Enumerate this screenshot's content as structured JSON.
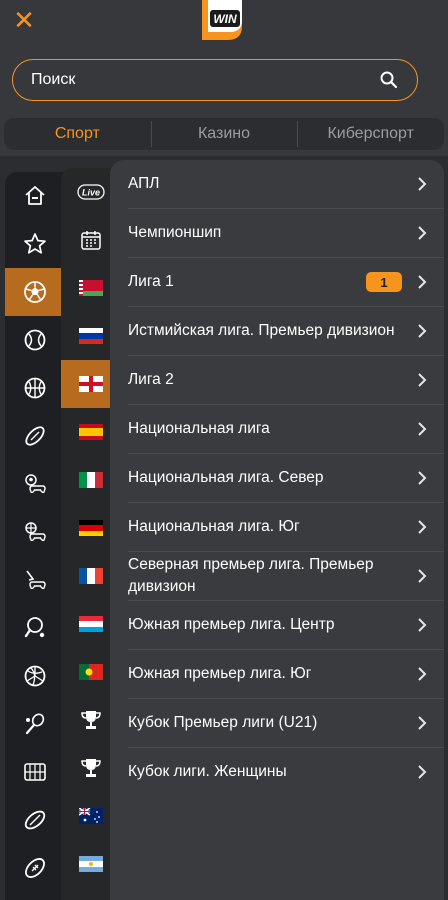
{
  "header": {
    "logo_text": "WIN",
    "close_icon": "close-icon",
    "accent": "#f7941d"
  },
  "search": {
    "placeholder": "Поиск"
  },
  "tabs": [
    {
      "label": "Спорт",
      "active": true
    },
    {
      "label": "Казино",
      "active": false
    },
    {
      "label": "Киберспорт",
      "active": false
    }
  ],
  "sports_sidebar": [
    {
      "icon": "home-icon"
    },
    {
      "icon": "star-icon"
    },
    {
      "icon": "soccer-ball-icon",
      "selected": true
    },
    {
      "icon": "tennis-ball-icon"
    },
    {
      "icon": "basketball-icon"
    },
    {
      "icon": "rugby-ball-icon"
    },
    {
      "icon": "esports-soccer-icon"
    },
    {
      "icon": "esports-basketball-icon"
    },
    {
      "icon": "esports-hockey-icon"
    },
    {
      "icon": "table-tennis-icon"
    },
    {
      "icon": "volleyball-icon"
    },
    {
      "icon": "badminton-icon"
    },
    {
      "icon": "futsal-icon"
    },
    {
      "icon": "rugby-league-icon"
    },
    {
      "icon": "american-football-icon"
    }
  ],
  "country_sidebar": {
    "live_label": "Live",
    "items": [
      {
        "icon": "live-icon"
      },
      {
        "icon": "calendar-icon"
      },
      {
        "icon": "belarus-flag-icon"
      },
      {
        "icon": "russia-flag-icon"
      },
      {
        "icon": "england-flag-icon",
        "selected": true
      },
      {
        "icon": "spain-flag-icon"
      },
      {
        "icon": "italy-flag-icon"
      },
      {
        "icon": "germany-flag-icon"
      },
      {
        "icon": "france-flag-icon"
      },
      {
        "icon": "luxembourg-flag-icon"
      },
      {
        "icon": "portugal-flag-icon"
      },
      {
        "icon": "trophy-icon"
      },
      {
        "icon": "trophy-icon"
      },
      {
        "icon": "australia-flag-icon"
      },
      {
        "icon": "argentina-flag-icon"
      }
    ]
  },
  "leagues": [
    {
      "label": "АПЛ"
    },
    {
      "label": "Чемпионшип"
    },
    {
      "label": "Лига 1",
      "badge": "1"
    },
    {
      "label": "Истмийская лига. Премьер дивизион"
    },
    {
      "label": "Лига 2"
    },
    {
      "label": "Национальная лига"
    },
    {
      "label": "Национальная лига. Север"
    },
    {
      "label": "Национальная лига. Юг"
    },
    {
      "label": "Северная премьер лига. Премьер дивизион"
    },
    {
      "label": "Южная премьер лига. Центр"
    },
    {
      "label": "Южная премьер лига. Юг"
    },
    {
      "label": "Кубок Премьер лиги (U21)"
    },
    {
      "label": "Кубок лиги. Женщины"
    }
  ]
}
